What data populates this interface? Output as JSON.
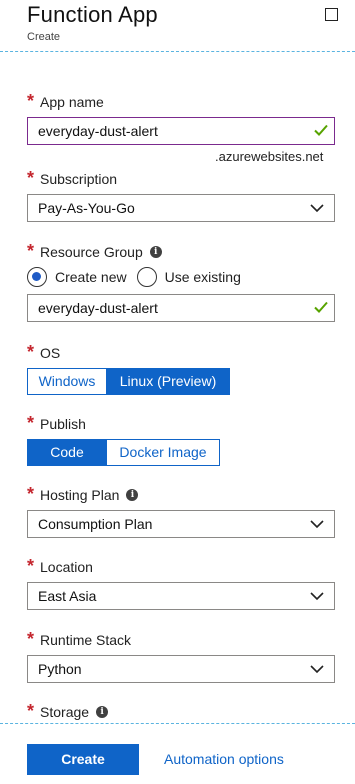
{
  "header": {
    "title": "Function App",
    "subtitle": "Create"
  },
  "app_name": {
    "label": "App name",
    "value": "everyday-dust-alert",
    "suffix": ".azurewebsites.net",
    "valid": true
  },
  "subscription": {
    "label": "Subscription",
    "value": "Pay-As-You-Go"
  },
  "resource_group": {
    "label": "Resource Group",
    "options": [
      {
        "label": "Create new",
        "selected": true
      },
      {
        "label": "Use existing",
        "selected": false
      }
    ],
    "value": "everyday-dust-alert",
    "valid": true
  },
  "os": {
    "label": "OS",
    "options": [
      {
        "label": "Windows",
        "selected": false
      },
      {
        "label": "Linux (Preview)",
        "selected": true
      }
    ]
  },
  "publish": {
    "label": "Publish",
    "options": [
      {
        "label": "Code",
        "selected": true
      },
      {
        "label": "Docker Image",
        "selected": false
      }
    ]
  },
  "hosting_plan": {
    "label": "Hosting Plan",
    "value": "Consumption Plan"
  },
  "location": {
    "label": "Location",
    "value": "East Asia"
  },
  "runtime_stack": {
    "label": "Runtime Stack",
    "value": "Python"
  },
  "storage": {
    "label": "Storage"
  },
  "footer": {
    "create_label": "Create",
    "automation_label": "Automation options"
  },
  "colors": {
    "accent": "#0f64c8",
    "required": "#c4262e",
    "valid": "#57a300",
    "focus_border": "#7b2a8e",
    "divider": "#5ab4e0"
  }
}
